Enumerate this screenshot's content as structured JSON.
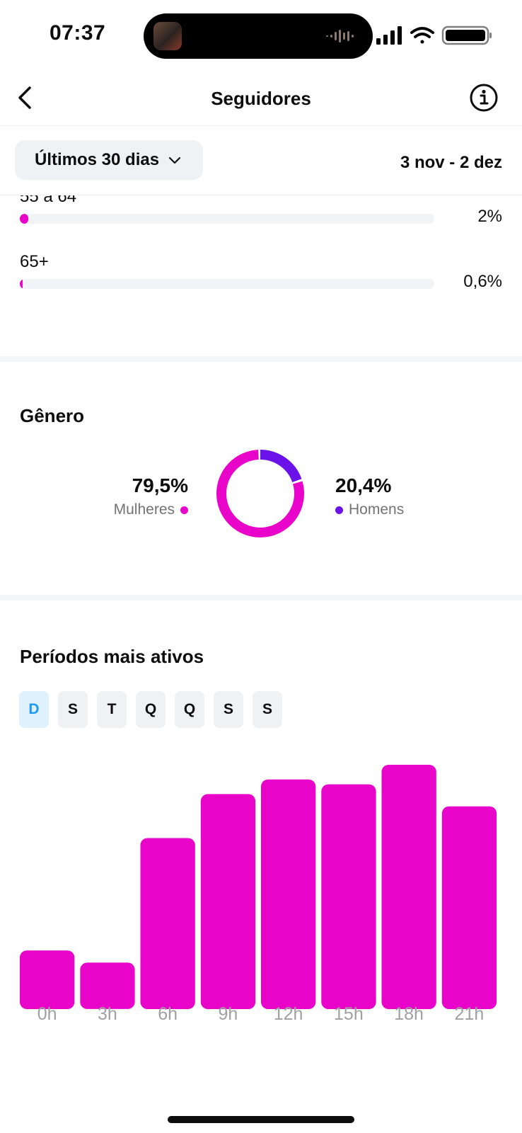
{
  "status": {
    "time": "07:37"
  },
  "header": {
    "title": "Seguidores"
  },
  "filter": {
    "period_label": "Últimos 30 dias",
    "date_range": "3 nov - 2 dez"
  },
  "age": {
    "rows": [
      {
        "label": "55 a 64",
        "percent_text": "2%",
        "fill_percent": 2
      },
      {
        "label": "65+",
        "percent_text": "0,6%",
        "fill_percent": 0.6
      }
    ]
  },
  "gender": {
    "title": "Gênero",
    "women": {
      "percent_text": "79,5%",
      "label": "Mulheres",
      "value": 79.5,
      "color": "#e805c9"
    },
    "men": {
      "percent_text": "20,4%",
      "label": "Homens",
      "value": 20.4,
      "color": "#6a12e8"
    }
  },
  "active_periods": {
    "title": "Períodos mais ativos",
    "days": [
      "D",
      "S",
      "T",
      "Q",
      "Q",
      "S",
      "S"
    ],
    "active_day_index": 0
  },
  "colors": {
    "accent": "#e805c9",
    "secondary": "#6a12e8",
    "active_day": "#1d9bf0"
  },
  "chart_data": {
    "type": "bar",
    "categories": [
      "0h",
      "3h",
      "6h",
      "9h",
      "12h",
      "15h",
      "18h",
      "21h"
    ],
    "values": [
      24,
      19,
      70,
      88,
      94,
      92,
      100,
      83
    ],
    "ylim": [
      0,
      100
    ],
    "grid": false,
    "color": "#e805c9"
  }
}
